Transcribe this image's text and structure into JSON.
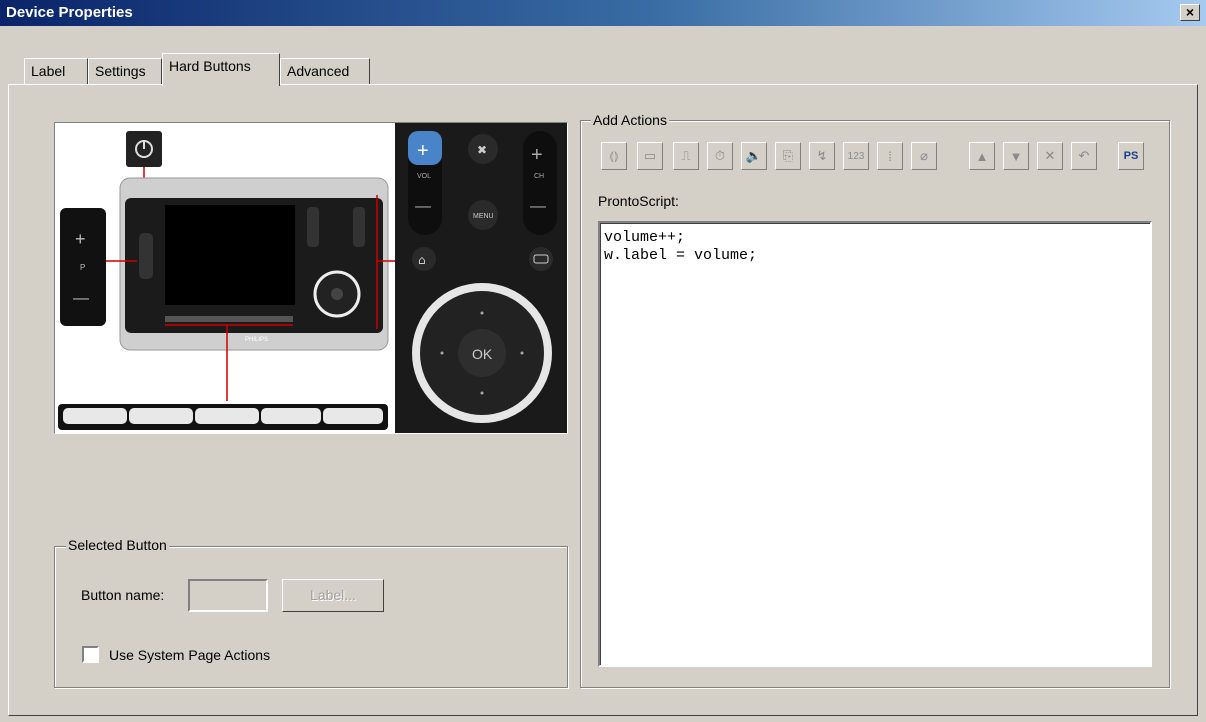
{
  "window": {
    "title": "Device Properties",
    "close_glyph": "×"
  },
  "tabs": [
    {
      "label": "Label",
      "active": false
    },
    {
      "label": "Settings",
      "active": false
    },
    {
      "label": "Hard Buttons",
      "active": true
    },
    {
      "label": "Advanced",
      "active": false
    }
  ],
  "remote": {
    "vol_label": "VOL",
    "ch_label": "CH",
    "menu_label": "MENU",
    "ok_label": "OK",
    "p_label": "P",
    "brand": "PHILIPS",
    "plus_glyph": "+",
    "minus_glyph": "—",
    "accent_color": "#4a84c8"
  },
  "selected_button": {
    "legend": "Selected Button",
    "name_label": "Button name:",
    "name_value": "",
    "label_button": "Label...",
    "use_system_actions_label": "Use System Page Actions",
    "use_system_actions_checked": false
  },
  "add_actions": {
    "legend": "Add Actions",
    "toolbar": [
      {
        "icon": "ir-code-icon",
        "glyph": "⦅⦆",
        "enabled": false
      },
      {
        "icon": "serial-icon",
        "glyph": "▭",
        "enabled": false
      },
      {
        "icon": "waveform-icon",
        "glyph": "⎍",
        "enabled": false
      },
      {
        "icon": "timer-icon",
        "glyph": "⏱",
        "enabled": false
      },
      {
        "icon": "sound-icon",
        "glyph": "🔈",
        "enabled": false
      },
      {
        "icon": "page-jump-icon",
        "glyph": "⎘",
        "enabled": false
      },
      {
        "icon": "macro-icon",
        "glyph": "↯",
        "enabled": false
      },
      {
        "icon": "number-icon",
        "glyph": "123",
        "enabled": false
      },
      {
        "icon": "variable-icon",
        "glyph": "⁞",
        "enabled": false
      },
      {
        "icon": "tag-icon",
        "glyph": "⌀",
        "enabled": false
      },
      {
        "icon": "move-up-icon",
        "glyph": "▲",
        "enabled": false
      },
      {
        "icon": "move-down-icon",
        "glyph": "▼",
        "enabled": false
      },
      {
        "icon": "delete-icon",
        "glyph": "✕",
        "enabled": false
      },
      {
        "icon": "undo-icon",
        "glyph": "↶",
        "enabled": false
      },
      {
        "icon": "prontoscript-icon",
        "glyph": "PS",
        "enabled": true
      }
    ],
    "script_label": "ProntoScript:",
    "script_lines": [
      "volume++;",
      "w.label = volume;"
    ]
  }
}
